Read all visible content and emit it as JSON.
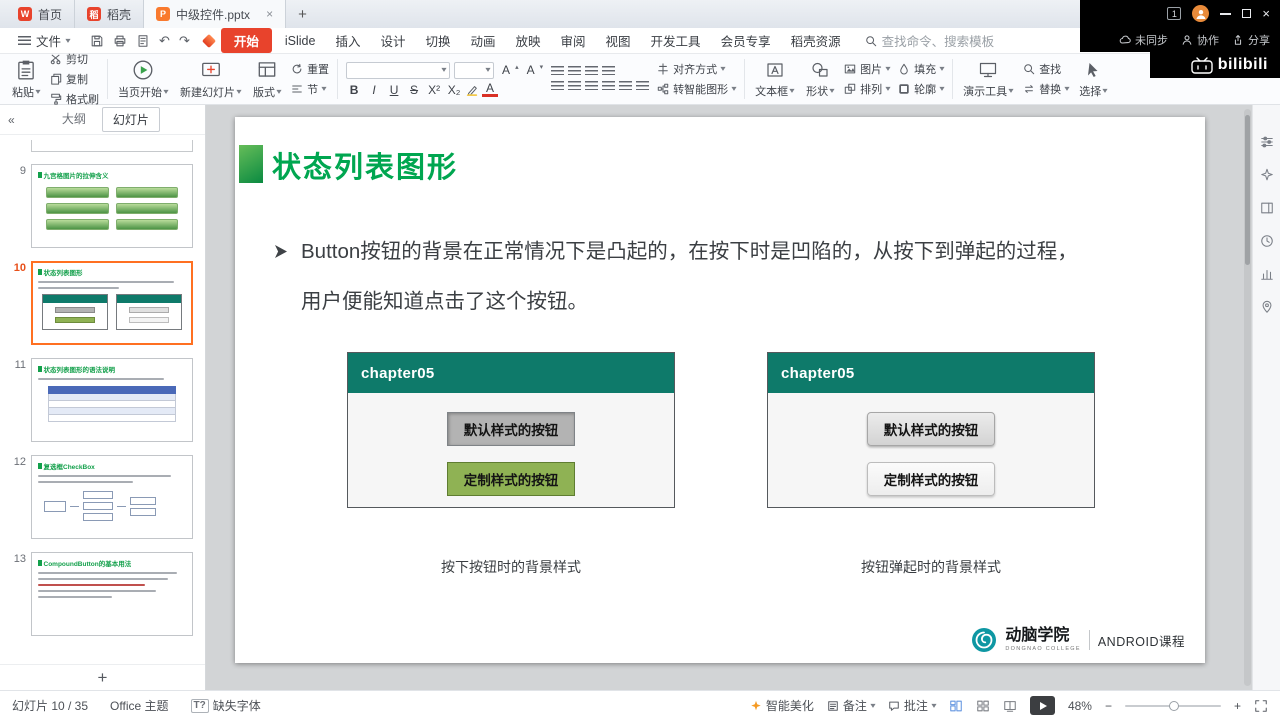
{
  "titlebar": {
    "tabs": [
      {
        "label": "首页"
      },
      {
        "label": "稻壳"
      }
    ],
    "doc_tab": "中级控件.pptx",
    "badge": "1"
  },
  "watermark": {
    "brand": "bilibili"
  },
  "menubar": {
    "file": "文件",
    "items": [
      "开始",
      "iSlide",
      "插入",
      "设计",
      "切换",
      "动画",
      "放映",
      "审阅",
      "视图",
      "开发工具",
      "会员专享",
      "稻壳资源"
    ],
    "search_placeholder": "查找命令、搜索模板",
    "sync": "未同步",
    "collab": "协作",
    "share": "分享"
  },
  "toolbar": {
    "paste": "粘贴",
    "cut": "剪切",
    "copy": "复制",
    "format_painter": "格式刷",
    "play_current": "当页开始",
    "new_slide": "新建幻灯片",
    "layout": "版式",
    "reset": "重置",
    "section": "节",
    "align_way": "对齐方式",
    "to_smartart": "转智能图形",
    "textbox": "文本框",
    "shape": "形状",
    "picture": "图片",
    "fill": "填充",
    "arrange": "排列",
    "outline": "轮廓",
    "present_tools": "演示工具",
    "find": "查找",
    "replace": "替换",
    "select": "选择",
    "format": {
      "bold": "B",
      "italic": "I",
      "underline": "U",
      "strike": "S",
      "color": "A",
      "sup": "X²",
      "sub": "X₂",
      "font_grow": "A",
      "font_shrink": "A"
    }
  },
  "sidebar": {
    "tab_outline": "大纲",
    "tab_slides": "幻灯片",
    "thumbs": [
      {
        "num": "9",
        "title": "九宫格图片的拉伸含义"
      },
      {
        "num": "10",
        "title": "状态列表图形"
      },
      {
        "num": "11",
        "title": "状态列表图形的语法说明"
      },
      {
        "num": "12",
        "title": "复选框CheckBox"
      },
      {
        "num": "13",
        "title": "CompoundButton的基本用法"
      }
    ]
  },
  "slide": {
    "title": "状态列表图形",
    "bullet_lines": [
      "Button按钮的背景在正常情况下是凸起的，在按下时是凹陷的，从按下到弹起的过程，",
      "用户便能知道点击了这个按钮。"
    ],
    "left_app": {
      "title": "chapter05",
      "button_default": "默认样式的按钮",
      "button_custom": "定制样式的按钮",
      "caption": "按下按钮时的背景样式"
    },
    "right_app": {
      "title": "chapter05",
      "button_default": "默认样式的按钮",
      "button_custom": "定制样式的按钮",
      "caption": "按钮弹起时的背景样式"
    },
    "brand": {
      "name": "动脑学院",
      "sub": "DONGNAO COLLEGE",
      "course": "ANDROID课程"
    }
  },
  "statusbar": {
    "slide_counter": "幻灯片 10 / 35",
    "theme": "Office 主题",
    "missing_font": "缺失字体",
    "missing_font_glyph": "T?",
    "beautify": "智能美化",
    "notes": "备注",
    "comments": "批注",
    "zoom": "48%"
  },
  "glyphs": {
    "caret": "▾",
    "plus": "+",
    "collapse": "«",
    "undo": "↶",
    "redo": "↷",
    "close": "×",
    "minus": "−"
  },
  "colors": {
    "accent_red": "#e8432c",
    "title_green": "#00a650",
    "app_header_teal": "#0e7a6a",
    "custom_button_green": "#8fb254",
    "selection_orange": "#ff7021"
  }
}
